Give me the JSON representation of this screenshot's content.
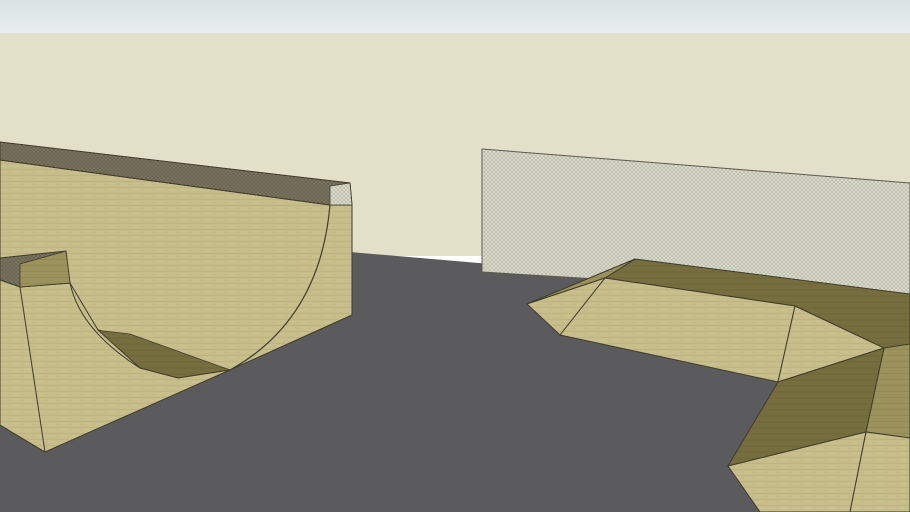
{
  "scene": {
    "description_objects": [
      "halfpipe-ramp",
      "funbox-ramp",
      "fence-panel",
      "ground",
      "sky"
    ]
  },
  "colors": {
    "sky_top": "#dde6e6",
    "sky_bottom": "#e4ecec",
    "horizon_wall": "#e2dfc8",
    "ground": "#5a5a5c",
    "wood_light": "#c9c08c",
    "wood_mid": "#b6ab74",
    "wood_dark": "#8f8550",
    "wood_shadow": "#6b6438",
    "fence": "#d6d6c6",
    "edge": "#3c3a2e"
  }
}
